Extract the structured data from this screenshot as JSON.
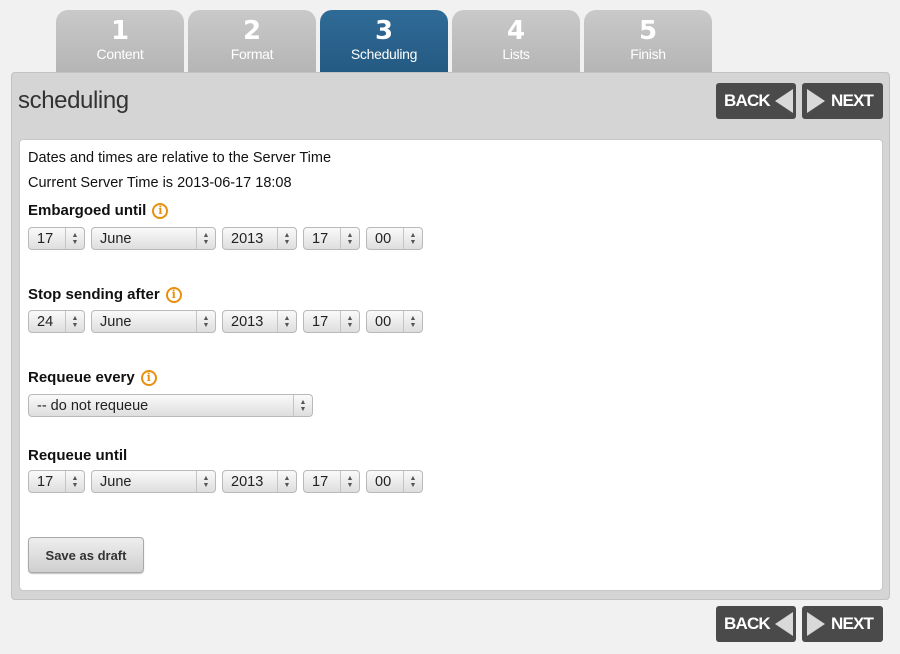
{
  "tabs": [
    {
      "number": "1",
      "label": "Content"
    },
    {
      "number": "2",
      "label": "Format"
    },
    {
      "number": "3",
      "label": "Scheduling"
    },
    {
      "number": "4",
      "label": "Lists"
    },
    {
      "number": "5",
      "label": "Finish"
    }
  ],
  "active_tab": "Scheduling",
  "page": {
    "title": "scheduling"
  },
  "nav": {
    "back_label": "BACK",
    "next_label": "NEXT"
  },
  "info": {
    "line1": "Dates and times are relative to the Server Time",
    "line2": "Current Server Time is 2013-06-17 18:08"
  },
  "embargo": {
    "label": "Embargoed until",
    "day": "17",
    "month": "June",
    "year": "2013",
    "hour": "17",
    "minute": "00"
  },
  "stop": {
    "label": "Stop sending after",
    "day": "24",
    "month": "June",
    "year": "2013",
    "hour": "17",
    "minute": "00"
  },
  "requeue_every": {
    "label": "Requeue every",
    "value": "-- do not requeue"
  },
  "requeue_until": {
    "label": "Requeue until",
    "day": "17",
    "month": "June",
    "year": "2013",
    "hour": "17",
    "minute": "00"
  },
  "actions": {
    "save_draft_label": "Save as draft"
  },
  "colors": {
    "active_tab": "#2a6390",
    "inactive_tab": "#bdbdbd",
    "info_icon": "#e8900c",
    "nav_button": "#4a4a4a"
  }
}
